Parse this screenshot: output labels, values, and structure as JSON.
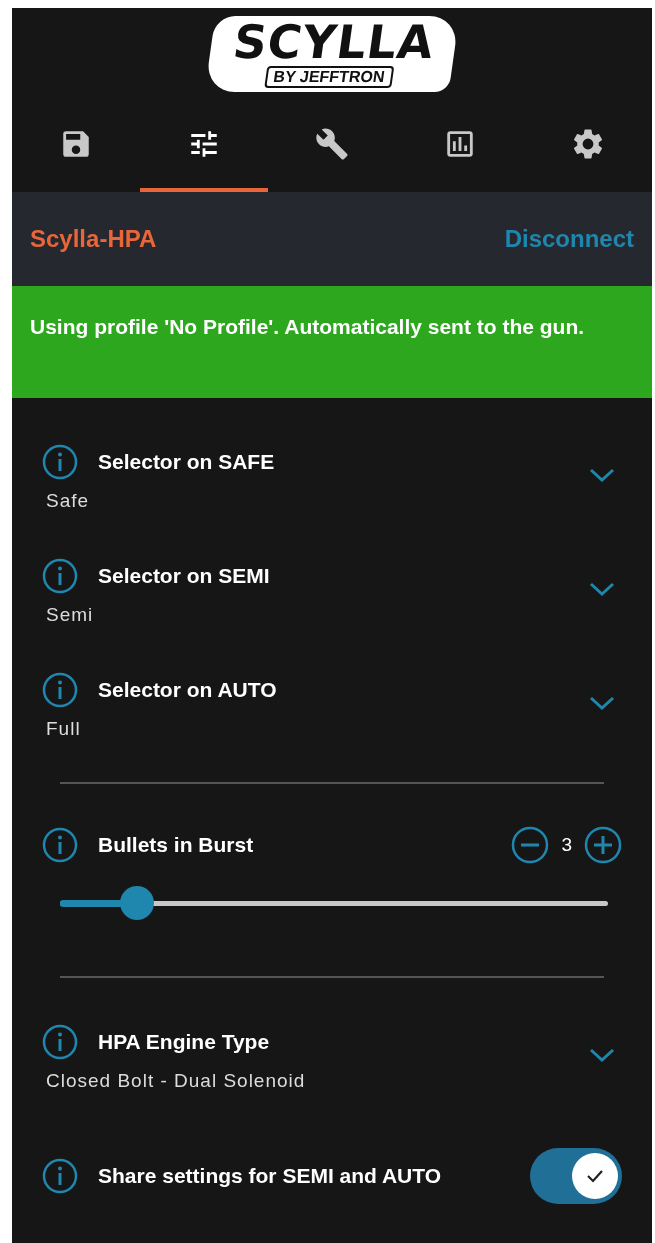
{
  "logo": {
    "title": "SCYLLA",
    "subtitle": "BY JEFFTRON"
  },
  "tabs": [
    {
      "kind": "save",
      "selected": false
    },
    {
      "kind": "sliders",
      "selected": true
    },
    {
      "kind": "wrench",
      "selected": false
    },
    {
      "kind": "chart",
      "selected": false
    },
    {
      "kind": "gear",
      "selected": false
    }
  ],
  "device": {
    "name": "Scylla-HPA",
    "action": "Disconnect"
  },
  "banner": "Using profile 'No Profile'. Automatically sent to the gun.",
  "settings": [
    {
      "kind": "dropdown",
      "label": "Selector on SAFE",
      "value": "Safe"
    },
    {
      "kind": "dropdown",
      "label": "Selector on SEMI",
      "value": "Semi"
    },
    {
      "kind": "dropdown",
      "label": "Selector on AUTO",
      "value": "Full"
    },
    {
      "kind": "divider"
    },
    {
      "kind": "stepper",
      "label": "Bullets in Burst",
      "value": "3",
      "level": 0.12
    },
    {
      "kind": "divider"
    },
    {
      "kind": "dropdown",
      "label": "HPA Engine Type",
      "value": "Closed Bolt - Dual Solenoid"
    },
    {
      "kind": "toggle",
      "label": "Share settings for SEMI and AUTO",
      "on": true
    }
  ]
}
